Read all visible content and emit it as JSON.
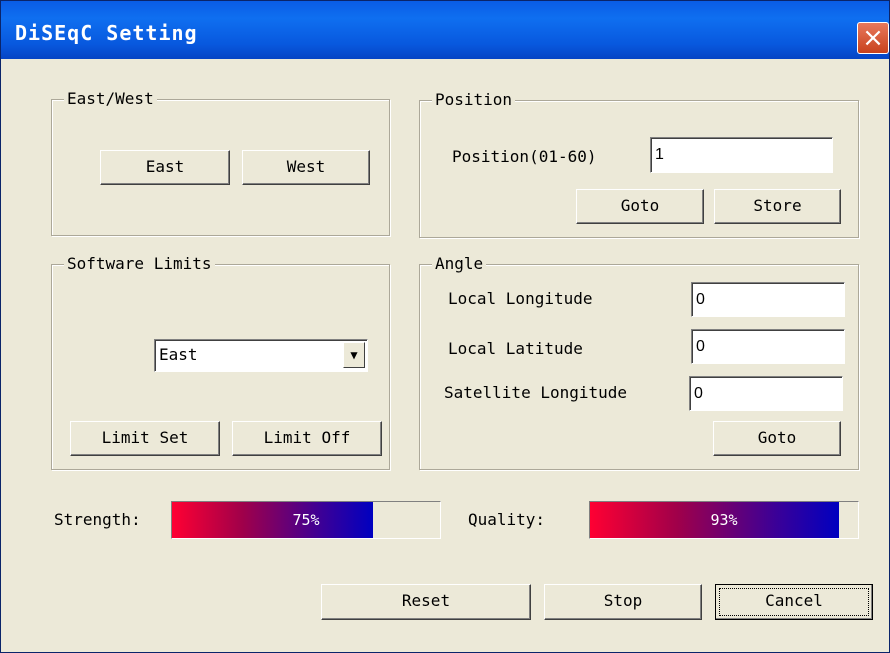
{
  "window": {
    "title": "DiSEqC Setting",
    "close_icon": "×"
  },
  "east_west": {
    "legend": "East/West",
    "east_label": "East",
    "west_label": "West"
  },
  "position": {
    "legend": "Position",
    "field_label": "Position(01-60)",
    "value": "1",
    "goto_label": "Goto",
    "store_label": "Store"
  },
  "software_limits": {
    "legend": "Software Limits",
    "direction_selected": "East",
    "limit_set_label": "Limit Set",
    "limit_off_label": "Limit Off"
  },
  "angle": {
    "legend": "Angle",
    "local_longitude_label": "Local Longitude",
    "local_longitude_value": "0",
    "local_latitude_label": "Local Latitude",
    "local_latitude_value": "0",
    "satellite_longitude_label": "Satellite Longitude",
    "satellite_longitude_value": "0",
    "goto_label": "Goto"
  },
  "signal": {
    "strength_label": "Strength:",
    "strength_percent": 75,
    "strength_text": "75%",
    "quality_label": "Quality:",
    "quality_percent": 93,
    "quality_text": "93%",
    "fill_colors": [
      "#ff0033",
      "#0000c0"
    ]
  },
  "footer": {
    "reset_label": "Reset",
    "stop_label": "Stop",
    "cancel_label": "Cancel"
  }
}
